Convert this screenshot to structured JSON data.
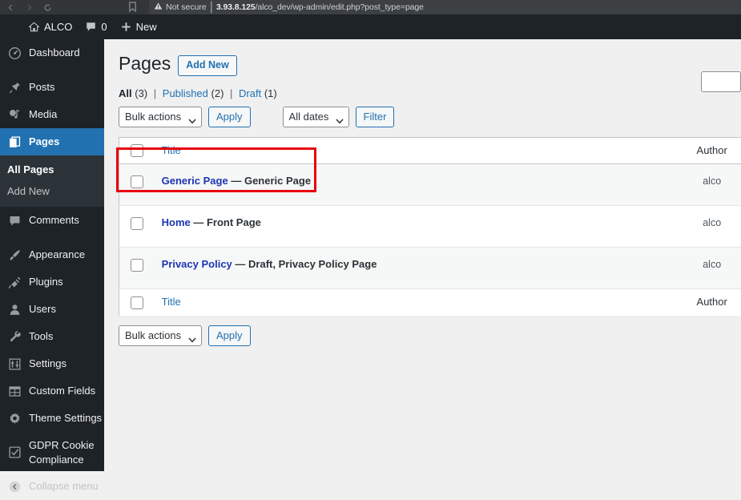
{
  "browser": {
    "back_icon": "back-arrow-icon",
    "forward_icon": "forward-arrow-icon",
    "reload_icon": "reload-icon",
    "bookmark_icon": "bookmark-icon",
    "security_label": "Not secure",
    "security_icon": "warning-triangle-icon",
    "url_host": "3.93.8.125",
    "url_path": "/alco_dev/wp-admin/edit.php?post_type=page"
  },
  "adminbar": {
    "site_name": "ALCO",
    "site_icon": "home-icon",
    "comments_icon": "comment-bubble-icon",
    "comments_count": "0",
    "new_icon": "plus-icon",
    "new_label": "New"
  },
  "sidebar": {
    "items": [
      {
        "label": "Dashboard",
        "icon": "dashboard-icon",
        "current": false
      },
      {
        "label": "Posts",
        "icon": "pin-icon",
        "current": false
      },
      {
        "label": "Media",
        "icon": "media-icon",
        "current": false
      },
      {
        "label": "Pages",
        "icon": "pages-icon",
        "current": true
      },
      {
        "label": "Comments",
        "icon": "comment-bubble-icon",
        "current": false
      },
      {
        "label": "Appearance",
        "icon": "paintbrush-icon",
        "current": false
      },
      {
        "label": "Plugins",
        "icon": "plug-icon",
        "current": false
      },
      {
        "label": "Users",
        "icon": "user-icon",
        "current": false
      },
      {
        "label": "Tools",
        "icon": "wrench-icon",
        "current": false
      },
      {
        "label": "Settings",
        "icon": "sliders-icon",
        "current": false
      },
      {
        "label": "Custom Fields",
        "icon": "grid-table-icon",
        "current": false
      },
      {
        "label": "Theme Settings",
        "icon": "gear-icon",
        "current": false
      },
      {
        "label": "GDPR Cookie Compliance",
        "icon": "checkbox-check-icon",
        "current": false
      }
    ],
    "submenu": {
      "parent": "Pages",
      "items": [
        {
          "label": "All Pages",
          "current": true
        },
        {
          "label": "Add New",
          "current": false
        }
      ]
    },
    "collapse": {
      "label": "Collapse menu",
      "icon": "collapse-arrow-icon"
    }
  },
  "page": {
    "title": "Pages",
    "add_new_label": "Add New"
  },
  "views": {
    "all_label": "All",
    "all_count": "(3)",
    "published_label": "Published",
    "published_count": "(2)",
    "draft_label": "Draft",
    "draft_count": "(1)",
    "separator": "|"
  },
  "tablenav_top": {
    "bulk_actions_value": "Bulk actions",
    "apply_label": "Apply",
    "dates_value": "All dates",
    "filter_label": "Filter",
    "chevron_icon": "chevron-down-icon"
  },
  "search": {
    "value": "",
    "placeholder": ""
  },
  "table": {
    "columns": {
      "cb": "select-all-checkbox",
      "title": "Title",
      "author": "Author"
    },
    "rows": [
      {
        "title": "Generic Page",
        "dash": "—",
        "state": "Generic Page",
        "author": "alco",
        "alternate": true,
        "highlighted": true
      },
      {
        "title": "Home",
        "dash": "—",
        "state": "Front Page",
        "author": "alco",
        "alternate": false,
        "highlighted": false
      },
      {
        "title": "Privacy Policy",
        "dash": "—",
        "state": "Draft, Privacy Policy Page",
        "author": "alco",
        "alternate": true,
        "highlighted": false
      }
    ]
  },
  "tablenav_bottom": {
    "bulk_actions_value": "Bulk actions",
    "apply_label": "Apply",
    "chevron_icon": "chevron-down-icon"
  },
  "annotation": {
    "highlight_color": "#e8000d",
    "target_row": "Generic Page"
  },
  "colors": {
    "wp_blue": "#2271b1",
    "admin_dark": "#1d2327",
    "submenu_dark": "#2c3338",
    "body_bg": "#f0f0f1",
    "row_alt": "#f6f7f7",
    "link_navy": "#1d35b4"
  }
}
